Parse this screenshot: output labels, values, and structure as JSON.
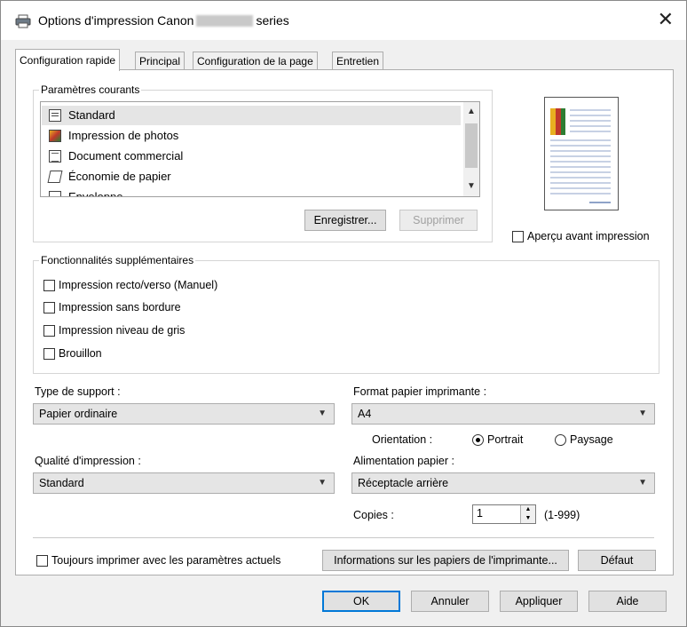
{
  "window": {
    "title_prefix": "Options d'impression Canon",
    "title_suffix": "series",
    "close_glyph": "✕"
  },
  "tabs": [
    {
      "label": "Configuration rapide",
      "active": true
    },
    {
      "label": "Principal"
    },
    {
      "label": "Configuration de la page"
    },
    {
      "label": "Entretien"
    }
  ],
  "current_settings": {
    "label": "Paramètres courants",
    "items": [
      {
        "label": "Standard",
        "icon": "standard-doc-icon"
      },
      {
        "label": "Impression de photos",
        "icon": "photo-icon"
      },
      {
        "label": "Document commercial",
        "icon": "business-doc-icon"
      },
      {
        "label": "Économie de papier",
        "icon": "paper-saving-icon"
      },
      {
        "label": "Enveloppe",
        "icon": "envelope-icon"
      }
    ],
    "save_button": "Enregistrer...",
    "delete_button": "Supprimer"
  },
  "preview": {
    "checkbox_label": "Aperçu avant impression"
  },
  "additional_features": {
    "label": "Fonctionnalités supplémentaires",
    "items": [
      {
        "label": "Impression recto/verso (Manuel)"
      },
      {
        "label": "Impression sans bordure"
      },
      {
        "label": "Impression niveau de gris"
      },
      {
        "label": "Brouillon"
      }
    ]
  },
  "media_type": {
    "label": "Type de support :",
    "value": "Papier ordinaire"
  },
  "paper_size": {
    "label": "Format papier imprimante :",
    "value": "A4"
  },
  "orientation": {
    "label": "Orientation :",
    "portrait": "Portrait",
    "landscape": "Paysage",
    "selected": "portrait"
  },
  "print_quality": {
    "label": "Qualité d'impression :",
    "value": "Standard"
  },
  "paper_source": {
    "label": "Alimentation papier :",
    "value": "Réceptacle arrière"
  },
  "copies": {
    "label": "Copies :",
    "value": "1",
    "range": "(1-999)"
  },
  "bottom": {
    "always_print_label": "Toujours imprimer avec les paramètres actuels",
    "paper_info_button": "Informations sur les papiers de l'imprimante...",
    "default_button": "Défaut"
  },
  "dialog_buttons": {
    "ok": "OK",
    "cancel": "Annuler",
    "apply": "Appliquer",
    "help": "Aide"
  }
}
